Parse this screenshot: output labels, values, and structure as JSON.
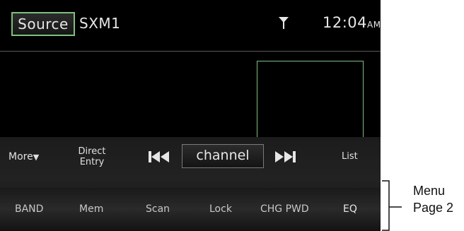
{
  "header": {
    "source_button": "Source",
    "source_name": "SXM1",
    "time": "12:04",
    "ampm": "AM",
    "signal_icon": "antenna-signal-icon"
  },
  "controls": {
    "more": "More",
    "more_arrow": "▼",
    "direct_line1": "Direct",
    "direct_line2": "Entry",
    "prev_icon": "skip-previous-icon",
    "channel": "channel",
    "next_icon": "skip-next-icon",
    "list": "List"
  },
  "menu": {
    "items": [
      "BAND",
      "Mem",
      "Scan",
      "Lock",
      "CHG PWD",
      "EQ"
    ]
  },
  "annotation": {
    "line1": "Menu",
    "line2": "Page 2"
  },
  "colors": {
    "accent_green": "#7fbf7f",
    "screen_bg": "#000000",
    "text": "#e6e6e6"
  }
}
